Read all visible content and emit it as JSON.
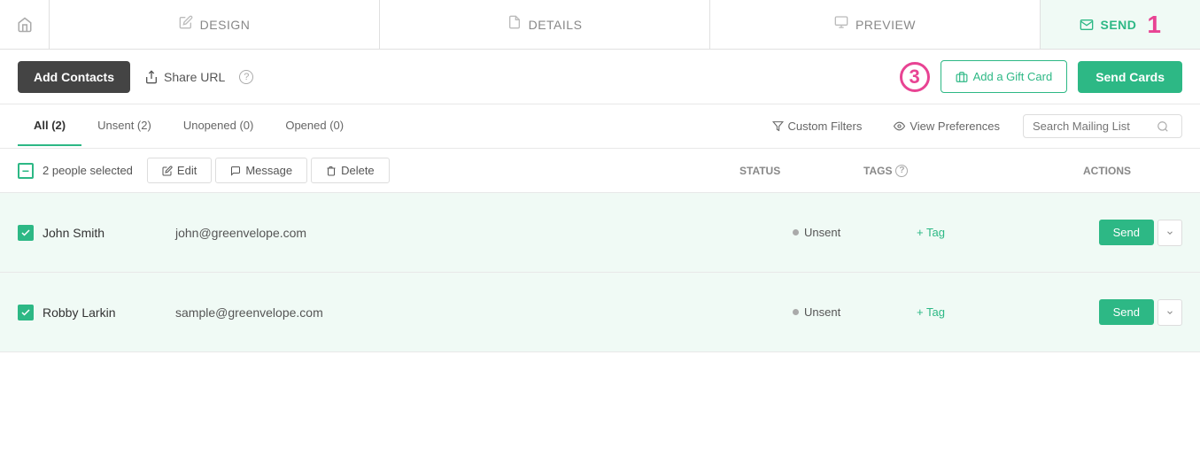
{
  "nav": {
    "home_icon": "⌂",
    "tabs": [
      {
        "id": "design",
        "label": "DESIGN",
        "icon": "✏"
      },
      {
        "id": "details",
        "label": "DETAILS",
        "icon": "📄"
      },
      {
        "id": "preview",
        "label": "PREVIEW",
        "icon": "🖼"
      }
    ],
    "send_label": "SEND",
    "send_step": "1"
  },
  "toolbar": {
    "add_contacts_label": "Add Contacts",
    "share_url_label": "Share URL",
    "help_icon": "?",
    "step3_label": "3",
    "add_gift_label": "Add a Gift Card",
    "send_cards_label": "Send Cards"
  },
  "filters": {
    "tabs": [
      {
        "id": "all",
        "label": "All (2)",
        "active": true
      },
      {
        "id": "unsent",
        "label": "Unsent (2)",
        "active": false
      },
      {
        "id": "unopened",
        "label": "Unopened (0)",
        "active": false
      },
      {
        "id": "opened",
        "label": "Opened (0)",
        "active": false
      }
    ],
    "custom_filters_label": "Custom Filters",
    "view_preferences_label": "View Preferences",
    "search_placeholder": "Search Mailing List"
  },
  "selection": {
    "count_label": "2 people selected",
    "edit_label": "Edit",
    "message_label": "Message",
    "delete_label": "Delete"
  },
  "table": {
    "headers": {
      "status": "Status",
      "tags": "Tags",
      "actions": "Actions"
    },
    "rows": [
      {
        "id": "row1",
        "name": "John Smith",
        "email": "john@greenvelope.com",
        "status": "Unsent",
        "tag_label": "+ Tag",
        "send_label": "Send",
        "checked": true
      },
      {
        "id": "row2",
        "name": "Robby Larkin",
        "email": "sample@greenvelope.com",
        "status": "Unsent",
        "tag_label": "+ Tag",
        "send_label": "Send",
        "checked": true
      }
    ]
  },
  "colors": {
    "green": "#2db885",
    "pink": "#e84393",
    "dark": "#444444"
  }
}
